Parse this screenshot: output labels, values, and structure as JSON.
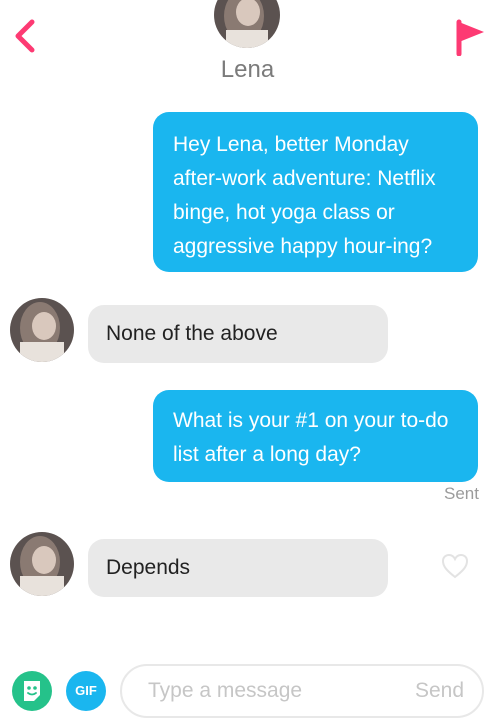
{
  "header": {
    "name": "Lena",
    "back_icon": "chevron-left-icon",
    "report_icon": "flag-icon"
  },
  "messages": [
    {
      "direction": "outgoing",
      "text": "Hey Lena, better Monday after-work adventure: Netflix binge, hot yoga class or aggressive happy hour-ing?"
    },
    {
      "direction": "incoming",
      "text": "None of the above"
    },
    {
      "direction": "outgoing",
      "text": "What is your #1 on your to-do list after a long day?",
      "status": "Sent"
    },
    {
      "direction": "incoming",
      "text": "Depends",
      "action_icon": "heart-icon"
    }
  ],
  "composer": {
    "sticker_icon": "bitmoji-sticker-icon",
    "gif_label": "GIF",
    "placeholder": "Type a message",
    "send_label": "Send"
  },
  "colors": {
    "accent": "#fd3a73",
    "outgoing_bubble": "#1ab6ef",
    "incoming_bubble": "#e9e9e9",
    "sticker_green": "#25c28a",
    "gif_blue": "#1ab6ef"
  }
}
